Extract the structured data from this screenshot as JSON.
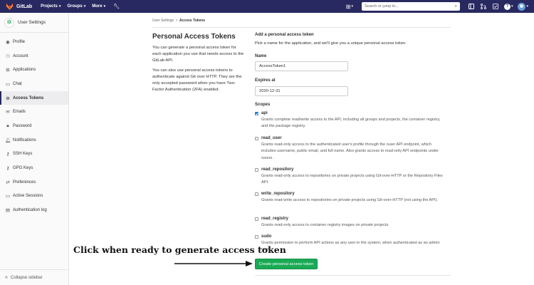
{
  "navbar": {
    "brand": "GitLab",
    "menu": [
      {
        "label": "Projects"
      },
      {
        "label": "Groups"
      },
      {
        "label": "More"
      }
    ],
    "search_placeholder": "Search or jump to...",
    "icons": [
      "wrench-icon",
      "plus-icon",
      "search-icon",
      "sidebar-icon",
      "merge-request-icon",
      "todo-icon",
      "help-icon",
      "avatar"
    ]
  },
  "sidebar": {
    "title": "User Settings",
    "items": [
      {
        "label": "Profile",
        "icon": "profile-icon"
      },
      {
        "label": "Account",
        "icon": "account-icon"
      },
      {
        "label": "Applications",
        "icon": "applications-icon"
      },
      {
        "label": "Chat",
        "icon": "chat-icon"
      },
      {
        "label": "Access Tokens",
        "icon": "token-icon",
        "active": true
      },
      {
        "label": "Emails",
        "icon": "mail-icon"
      },
      {
        "label": "Password",
        "icon": "lock-icon"
      },
      {
        "label": "Notifications",
        "icon": "bell-icon"
      },
      {
        "label": "SSH Keys",
        "icon": "key-icon"
      },
      {
        "label": "GPG Keys",
        "icon": "key-icon"
      },
      {
        "label": "Preferences",
        "icon": "preferences-icon"
      },
      {
        "label": "Active Sessions",
        "icon": "monitor-icon"
      },
      {
        "label": "Authentication log",
        "icon": "log-icon"
      }
    ],
    "collapse_label": "Collapse sidebar"
  },
  "breadcrumb": {
    "parent": "User Settings",
    "current": "Access Tokens"
  },
  "intro": {
    "title": "Personal Access Tokens",
    "p1": "You can generate a personal access token for each application you use that needs access to the GitLab API.",
    "p2": "You can also use personal access tokens to authenticate against Git over HTTP. They are the only accepted password when you have Two-Factor Authentication (2FA) enabled."
  },
  "form": {
    "heading": "Add a personal access token",
    "subheading": "Pick a name for the application, and we'll give you a unique personal access token.",
    "name_label": "Name",
    "name_value": "AccessToken1",
    "expires_label": "Expires at",
    "expires_value": "2020-12-31",
    "scopes_label": "Scopes",
    "scopes": [
      {
        "name": "api",
        "checked": true,
        "description": "Grants complete read/write access to the API, including all groups and projects, the container registry, and the package registry."
      },
      {
        "name": "read_user",
        "checked": false,
        "description": "Grants read-only access to the authenticated user's profile through the /user API endpoint, which includes username, public email, and full name. Also grants access to read-only API endpoints under /users."
      },
      {
        "name": "read_repository",
        "checked": false,
        "description": "Grants read-only access to repositories on private projects using Git-over-HTTP or the Repository Files API."
      },
      {
        "name": "write_repository",
        "checked": false,
        "description": "Grants read-write access to repositories on private projects using Git-over-HTTP (not using the API)."
      },
      {
        "name": "read_registry",
        "checked": false,
        "description": "Grants read-only access to container registry images on private projects."
      },
      {
        "name": "sudo",
        "checked": false,
        "description": "Grants permission to perform API actions as any user in the system, when authenticated as an admin user."
      }
    ],
    "submit_label": "Create personal access token"
  },
  "annotation": {
    "text": "Click when ready to generate access token"
  },
  "colors": {
    "navbar": "#292961",
    "submit": "#1aaa55",
    "checkbox": "#1f78d1"
  }
}
